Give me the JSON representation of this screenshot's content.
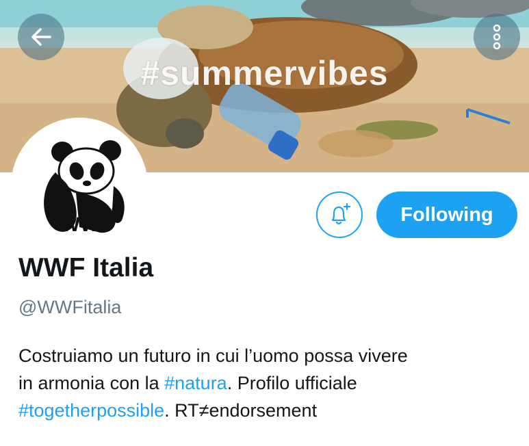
{
  "header": {
    "banner_overlay_text": "#summervibes",
    "back_icon": "arrow-left-icon",
    "more_icon": "vertical-ellipsis-icon"
  },
  "profile": {
    "avatar_logo_text": "WWF",
    "display_name": "WWF Italia",
    "handle": "@WWFitalia",
    "bio": {
      "line1": "Costruiamo un futuro in cui l’uomo possa vivere",
      "line2_prefix": "in armonia con la ",
      "hashtag1": "#natura",
      "line2_suffix": ". Profilo ufficiale",
      "hashtag2": "#togetherpossible",
      "line3_suffix": ". RT≠endorsement"
    }
  },
  "actions": {
    "notification_icon": "bell-plus-icon",
    "following_label": "Following"
  },
  "colors": {
    "accent": "#1da1f2",
    "text_primary": "#14171a",
    "text_secondary": "#657786"
  }
}
